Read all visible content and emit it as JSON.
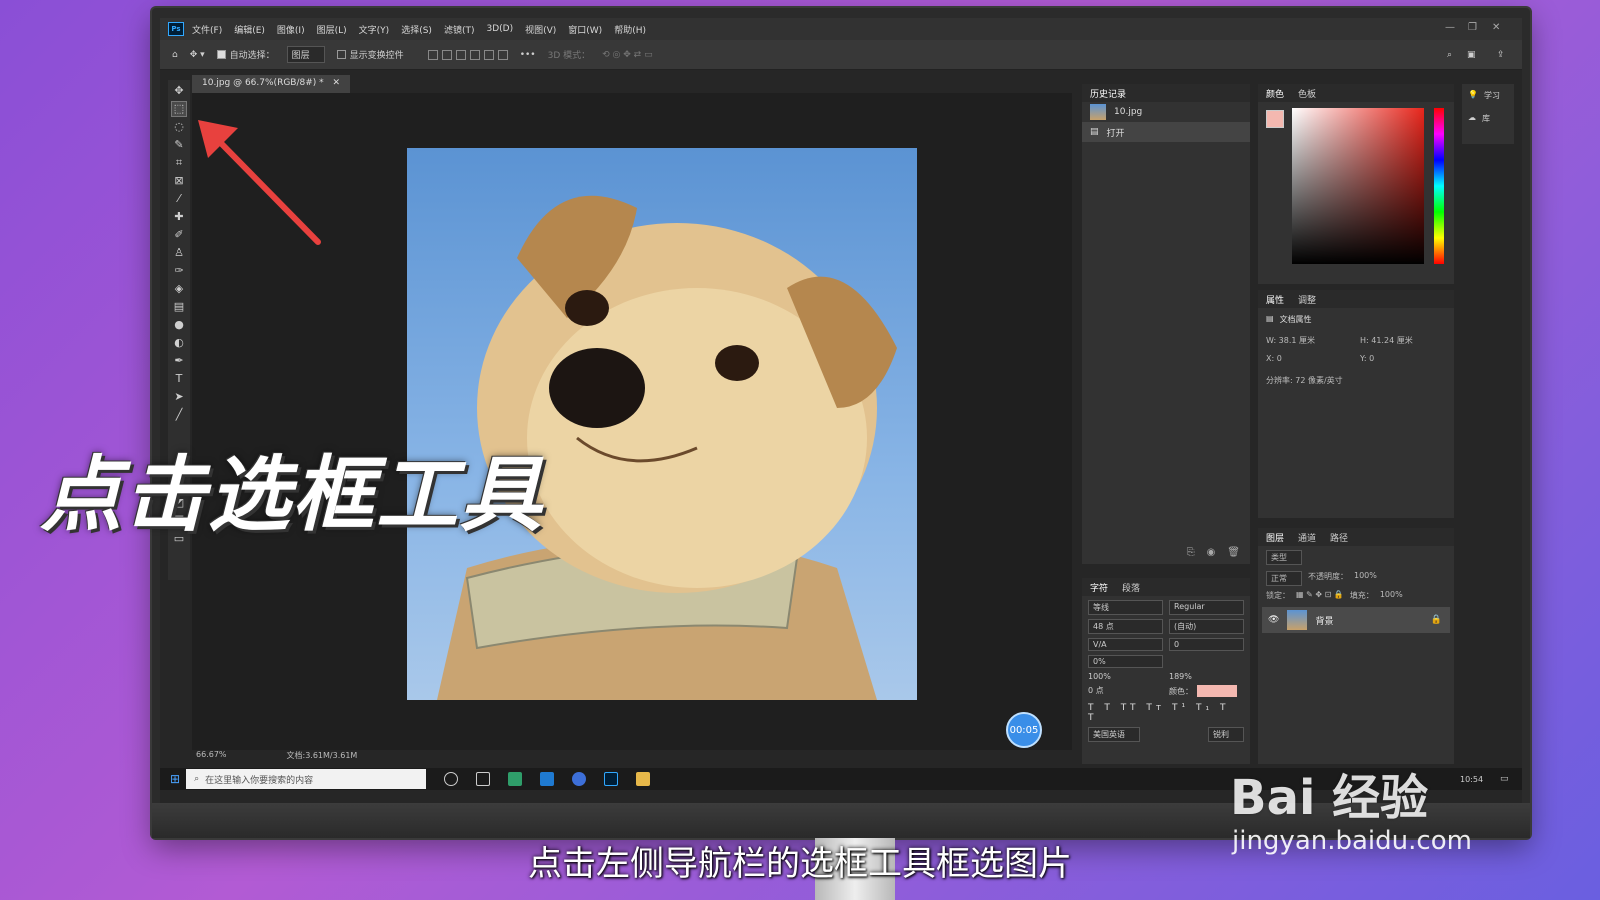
{
  "menubar": {
    "items": [
      "文件(F)",
      "编辑(E)",
      "图像(I)",
      "图层(L)",
      "文字(Y)",
      "选择(S)",
      "滤镜(T)",
      "3D(D)",
      "视图(V)",
      "窗口(W)",
      "帮助(H)"
    ]
  },
  "options": {
    "auto_select_label": "自动选择：",
    "auto_select_value": "图层",
    "show_transform_label": "显示变换控件",
    "mode_3d_label": "3D 模式："
  },
  "document": {
    "tab_title": "10.jpg @ 66.7%(RGB/8#) *",
    "zoom": "66.67%",
    "doc_info": "文档:3.61M/3.61M"
  },
  "history": {
    "tab": "历史记录",
    "snapshot": "10.jpg",
    "step": "打开"
  },
  "color_panel": {
    "tabs": [
      "颜色",
      "色板"
    ],
    "foreground_color": "#f4b8b0",
    "hue_color": "#e8261c"
  },
  "learn_panel": {
    "learn_label": "学习",
    "library_label": "库"
  },
  "properties": {
    "tabs": [
      "属性",
      "调整"
    ],
    "doc_props_label": "文档属性",
    "width": "W: 38.1 厘米",
    "height": "H: 41.24 厘米",
    "x": "X: 0",
    "y": "Y: 0",
    "resolution": "分辨率: 72 像素/英寸"
  },
  "character": {
    "tabs": [
      "字符",
      "段落"
    ],
    "font_family": "等线",
    "font_style": "Regular",
    "font_size": "48 点",
    "leading": "(自动)",
    "kerning_val": "0",
    "tracking": "0%",
    "vert_scale": "100%",
    "horiz_scale": "189%",
    "baseline": "0 点",
    "color_label": "颜色：",
    "language": "美国英语",
    "aa_label": "锐利"
  },
  "layers": {
    "tabs": [
      "图层",
      "通道",
      "路径"
    ],
    "filter_label": "类型",
    "blend_mode": "正常",
    "opacity_label": "不透明度：",
    "opacity": "100%",
    "lock_label": "锁定：",
    "fill_label": "填充：",
    "fill": "100%",
    "layer_name": "背景"
  },
  "timer": "00:05",
  "taskbar": {
    "search_placeholder": "在这里输入你要搜索的内容",
    "time": "10:54"
  },
  "overlay": {
    "big_caption": "点击选框工具",
    "subtitle": "点击左侧导航栏的选框工具框选图片",
    "watermark_logo": "Bai 经验",
    "watermark_url": "jingyan.baidu.com"
  },
  "colors": {
    "arrow": "#e8413e",
    "timer_bg": "#3a8ee8"
  }
}
